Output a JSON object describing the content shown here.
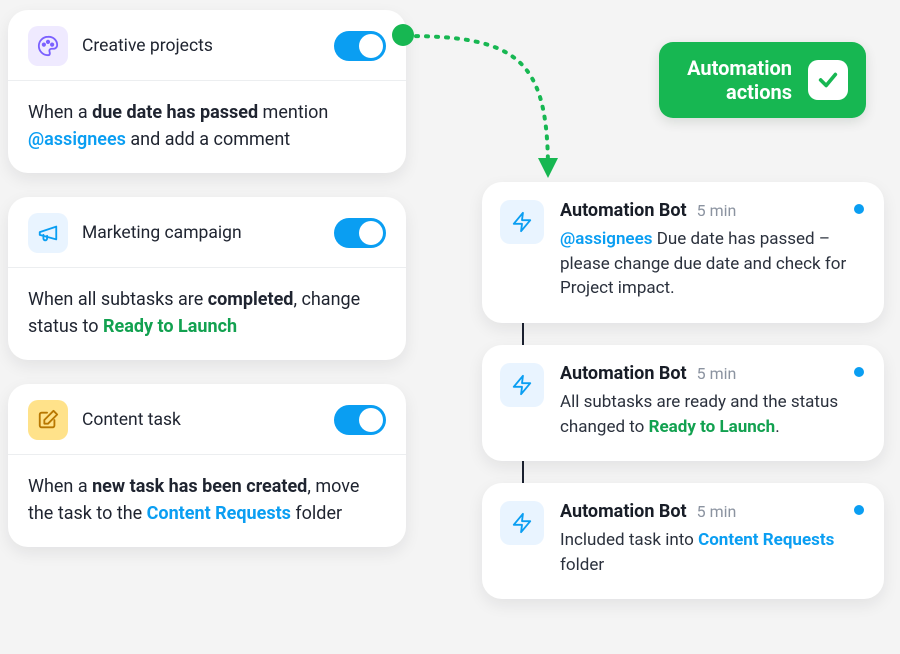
{
  "colors": {
    "purple_bg": "#efeaff",
    "purple_fg": "#7b61ff",
    "blue_bg": "#e9f4ff",
    "blue_fg": "#0a9ef2",
    "yellow_bg": "#ffe28a",
    "yellow_fg": "#b87700",
    "green": "#17b752",
    "status_green": "#12a150"
  },
  "rules": [
    {
      "title": "Creative projects",
      "icon": "palette-icon",
      "body": {
        "prefix": "When a ",
        "bold1": "due date has passed",
        "mid": " mention ",
        "mention": "@assignees",
        "suffix": " and add a comment"
      }
    },
    {
      "title": "Marketing campaign",
      "icon": "megaphone-icon",
      "body": {
        "prefix": "When all subtasks are ",
        "bold1": "completed",
        "mid": ", change status to ",
        "status": "Ready to Launch"
      }
    },
    {
      "title": "Content task",
      "icon": "edit-icon",
      "body": {
        "prefix": "When a ",
        "bold1": "new task has been created",
        "mid": ", move the task to the ",
        "link": "Content Requests",
        "suffix": " folder"
      }
    }
  ],
  "actions_badge": {
    "line1": "Automation",
    "line2": "actions"
  },
  "notifs": [
    {
      "title": "Automation Bot",
      "time": "5 min",
      "body": {
        "mention": "@assignees",
        "text": " Due date has passed – please change due date and check for Project impact."
      }
    },
    {
      "title": "Automation Bot",
      "time": "5 min",
      "body": {
        "text1": "All subtasks are ready and the status changed to ",
        "status": "Ready to Launch",
        "text2": "."
      }
    },
    {
      "title": "Automation Bot",
      "time": "5 min",
      "body": {
        "text1": "Included task into ",
        "link": "Content Requests",
        "text2": " folder"
      }
    }
  ]
}
